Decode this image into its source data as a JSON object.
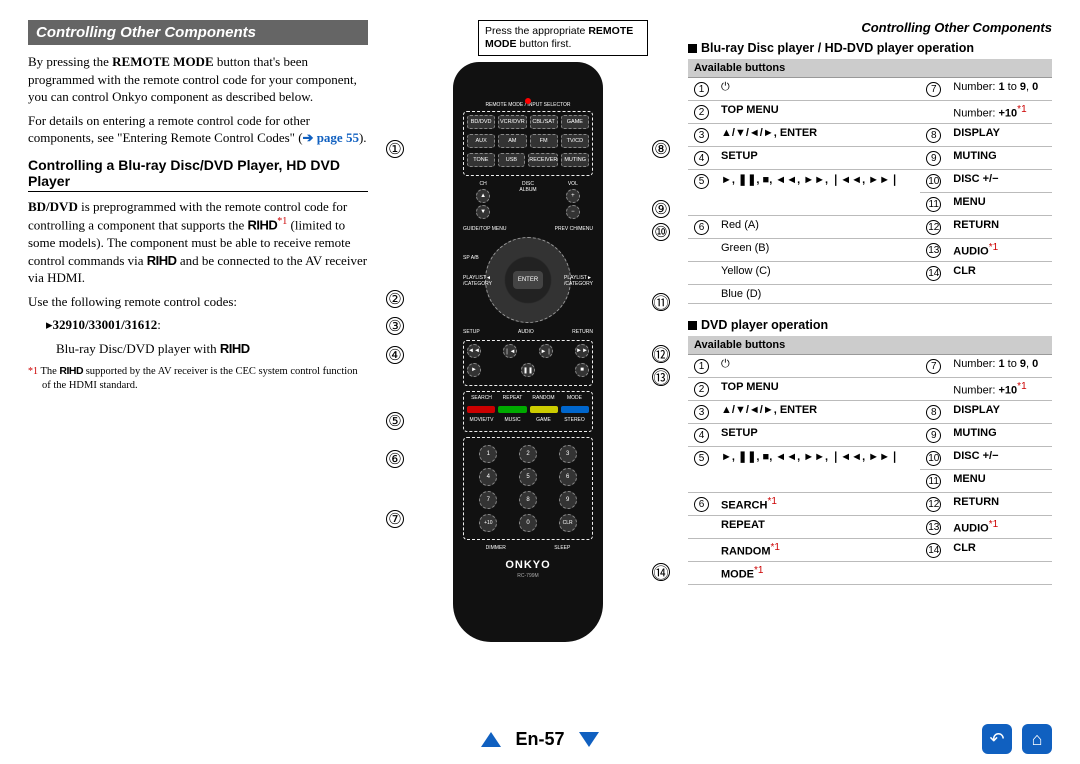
{
  "header_small": "Controlling Other Components",
  "banner": "Controlling Other Components",
  "intro1a": "By pressing the ",
  "intro1b": "REMOTE MODE",
  "intro1c": " button that's been programmed with the remote control code for your component, you can control Onkyo component as described below.",
  "intro2a": "For details on entering a remote control code for other components, see \"Entering Remote Control Codes\" (",
  "intro2link": "➔ page 55",
  "intro2b": ").",
  "sub1": "Controlling a Blu-ray Disc/DVD Player, HD DVD Player",
  "p2a": "BD/DVD",
  "p2b": " is preprogrammed with the remote control code for controlling a component that supports the ",
  "rihd": "RIHD",
  "p2c": " (limited to some models). The component must be able to receive remote control commands via ",
  "p2d": " and be connected to the AV receiver via HDMI.",
  "p3": "Use the following remote control codes:",
  "codes": "32910/33001/31612",
  "codes_desc": "Blu-ray Disc/DVD player with ",
  "fn1a": "The ",
  "fn1b": " supported by the AV receiver is the CEC system control function of the HDMI standard.",
  "callout_a": "Press the appropriate ",
  "callout_b": "REMOTE MODE",
  "callout_c": " button first.",
  "remote_brand": "ONKYO",
  "remote_model": "RC-799M",
  "bluray_title": "Blu-ray Disc player / HD-DVD player operation",
  "dvd_title": "DVD player operation",
  "th_available": "Available buttons",
  "bl": {
    "r1a": "⏻",
    "r1b": "Number: ",
    "r1b2": "1",
    " r1b3": " to ",
    "r1b4": "9",
    "r1b5": ", ",
    "r1b6": "0",
    "r2a": "TOP MENU",
    "r2b": "Number: ",
    "r2b2": "+10",
    "r3a": "▲/▼/◄/►, ENTER",
    "r3b": "DISPLAY",
    "r4a": "SETUP",
    "r4b": "MUTING",
    "r5a": "►, ❚❚, ■, ◄◄, ►►, ❘◄◄, ►►❘",
    "r5b": "DISC +/−",
    "r6b": "MENU",
    "r6a": "Red (A)",
    "r7b": "RETURN",
    "r7a": "Green (B)",
    "r8b": "AUDIO",
    "r8a": "Yellow (C)",
    "r9b": "CLR",
    "r9a": "Blue (D)"
  },
  "dv": {
    "r1a": "⏻",
    "r1b": "Number: ",
    "r1b2": "1",
    "r1b3": " to ",
    "r1b4": "9",
    "r1b5": ", ",
    "r1b6": "0",
    "r2a": "TOP MENU",
    "r2b": "Number: ",
    "r2b2": "+10",
    "r3a": "▲/▼/◄/►, ENTER",
    "r3b": "DISPLAY",
    "r4a": "SETUP",
    "r4b": "MUTING",
    "r5a": "►, ❚❚, ■, ◄◄, ►►, ❘◄◄, ►►❘",
    "r5b": "DISC +/−",
    "r6b": "MENU",
    "r6a": "SEARCH",
    "r7b": "RETURN",
    "r7a": "REPEAT",
    "r8b": "AUDIO",
    "r8a": "RANDOM",
    "r9b": "CLR",
    "r9a": "MODE"
  },
  "page_num": "En-57"
}
